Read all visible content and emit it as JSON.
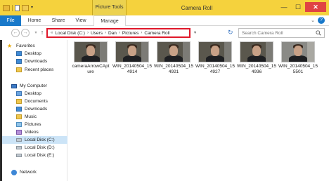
{
  "window": {
    "title": "Camera Roll",
    "context_tab_group": "Picture Tools",
    "controls": {
      "minimize": "—",
      "maximize": "☐",
      "close": "✕"
    }
  },
  "ribbon": {
    "tabs": [
      "File",
      "Home",
      "Share",
      "View",
      "Manage"
    ],
    "help": "?",
    "expand": "⌄"
  },
  "navigation": {
    "back": "←",
    "forward": "→",
    "recent": "▾",
    "up": "↑",
    "address_prefix": "«",
    "breadcrumb": [
      "Local Disk (C:)",
      "Users",
      "Dan",
      "Pictures",
      "Camera Roll"
    ],
    "breadcrumb_sep": "›",
    "dropdown": "▾",
    "refresh": "↻",
    "search_placeholder": "Search Camera Roll"
  },
  "navpane": {
    "favorites_header": "Favorites",
    "favorites": [
      "Desktop",
      "Downloads",
      "Recent places"
    ],
    "computer_header": "My Computer",
    "computer": [
      "Desktop",
      "Documents",
      "Downloads",
      "Music",
      "Pictures",
      "Videos",
      "Local Disk (C:)",
      "Local Disk (D:)",
      "Local Disk (E:)"
    ],
    "selected": "Local Disk (C:)",
    "network_header": "Network"
  },
  "files": [
    {
      "name": "cameraArrowCApture"
    },
    {
      "name": "WIN_20140504_154914"
    },
    {
      "name": "WIN_20140504_154921"
    },
    {
      "name": "WIN_20140504_154927"
    },
    {
      "name": "WIN_20140504_154936"
    },
    {
      "name": "WIN_20140504_155501"
    }
  ],
  "colors": {
    "titlebar": "#f5d23d",
    "file_tab": "#1979ca",
    "address_highlight": "#e0182a",
    "selection": "#cce4f7"
  }
}
